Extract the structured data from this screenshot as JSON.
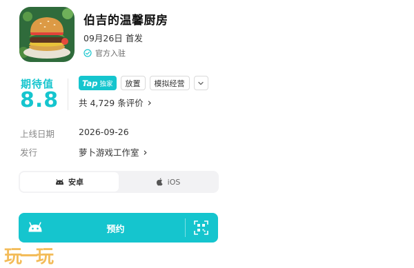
{
  "game": {
    "title": "伯吉的温馨厨房",
    "release_date_short": "09月26日",
    "release_tag": "首发",
    "official_label": "官方入驻"
  },
  "rating": {
    "label": "期待值",
    "value": "8.8"
  },
  "tags": {
    "tap_badge": "Tap",
    "exclusive": "独家",
    "items": [
      "放置",
      "模拟经营"
    ],
    "more_icon": "chevron-down-icon"
  },
  "reviews": {
    "text": "共 4,729 条评价",
    "arrow": "›"
  },
  "info": {
    "launch_label": "上线日期",
    "launch_value": "2026-09-26",
    "publisher_label": "发行",
    "publisher_value": "萝卜游戏工作室",
    "publisher_arrow": "›"
  },
  "platforms": {
    "android": "安卓",
    "ios": "iOS",
    "selected": "android"
  },
  "cta": {
    "label": "预约",
    "left_icon": "android-icon",
    "right_icon": "qr-scan-icon"
  },
  "watermark": "玩一玩",
  "colors": {
    "accent": "#15c5ce",
    "watermark": "#f2b13e"
  }
}
